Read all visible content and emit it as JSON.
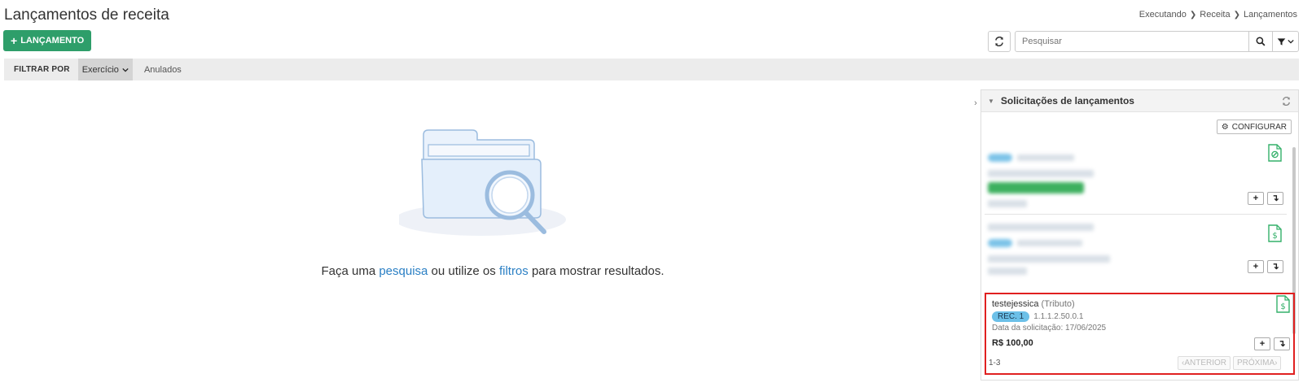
{
  "header": {
    "title": "Lançamentos de receita",
    "breadcrumb": [
      "Executando",
      "Receita",
      "Lançamentos"
    ]
  },
  "toolbar": {
    "new_button_label": "LANÇAMENTO",
    "search_placeholder": "Pesquisar"
  },
  "filter_bar": {
    "label": "FILTRAR POR",
    "select_value": "Exercício",
    "tab_label": "Anulados"
  },
  "empty_state": {
    "prefix": "Faça uma ",
    "link_search": "pesquisa",
    "middle": " ou utilize os ",
    "link_filters": "filtros",
    "suffix": " para mostrar resultados."
  },
  "panel": {
    "title": "Solicitações de lançamentos",
    "config_label": "CONFIGURAR",
    "highlighted_card": {
      "name": "testejessica",
      "type": "(Tributo)",
      "badge": "REC. 1",
      "code": "1.1.1.2.50.0.1",
      "date": "Data da solicitação: 17/06/2025",
      "value": "R$ 100,00"
    },
    "pagination": {
      "count": "1-3",
      "prev_label": "ANTERIOR",
      "next_label": "PRÓXIMA"
    }
  },
  "colors": {
    "primary_green": "#2e9e6a",
    "link_blue": "#2a7fc4",
    "highlight_red": "#e02020",
    "badge_blue": "#6cc0e8"
  }
}
